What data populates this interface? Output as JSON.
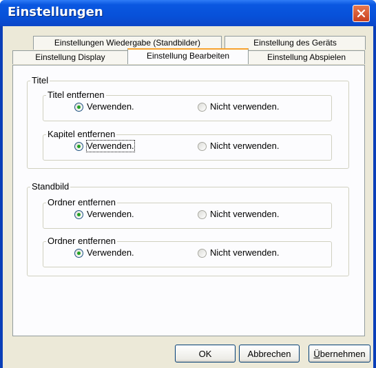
{
  "window": {
    "title": "Einstellungen",
    "close_label": "×"
  },
  "tabs_back": [
    {
      "label": "Einstellungen Wiedergabe (Standbilder)"
    },
    {
      "label": "Einstellung des Geräts"
    }
  ],
  "tabs_front": [
    {
      "label": "Einstellung Display"
    },
    {
      "label": "Einstellung Bearbeiten",
      "active": true
    },
    {
      "label": "Einstellung Abspielen"
    }
  ],
  "sections": [
    {
      "title": "Titel",
      "groups": [
        {
          "title": "Titel entfernen",
          "use": "Verwenden.",
          "not_use": "Nicht verwenden.",
          "selected": "use"
        },
        {
          "title": "Kapitel entfernen",
          "use": "Verwenden.",
          "not_use": "Nicht verwenden.",
          "selected": "use"
        }
      ]
    },
    {
      "title": "Standbild",
      "groups": [
        {
          "title": "Ordner entfernen",
          "use": "Verwenden.",
          "not_use": "Nicht verwenden.",
          "selected": "use"
        },
        {
          "title": "Ordner entfernen",
          "use": "Verwenden.",
          "not_use": "Nicht verwenden.",
          "selected": "use"
        }
      ]
    }
  ],
  "buttons": {
    "ok": "OK",
    "cancel": "Abbrechen",
    "apply_u": "Ü",
    "apply_rest": "bernehmen"
  }
}
